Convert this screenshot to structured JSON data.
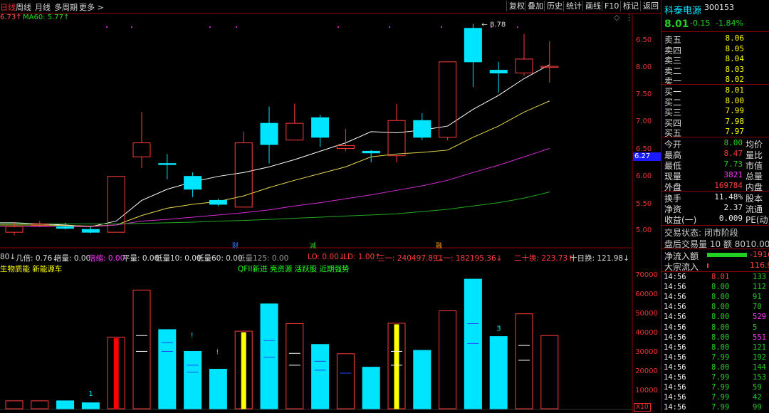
{
  "toolbar": {
    "tabs": [
      "日线",
      "周线",
      "月线",
      "多周期",
      "更多 >"
    ],
    "buttons": [
      "复权",
      "叠加",
      "历史",
      "统计",
      "画线",
      "F10",
      "标记",
      "返回"
    ]
  },
  "ma_header": {
    "ma_last": "6.73↑",
    "ma60": "MA60: 5.77↑"
  },
  "price_axis": [
    "6.50",
    "6.00",
    "5.50",
    "5.00",
    "6.27",
    "7.50",
    "7.00",
    "8.00"
  ],
  "axis_price_list": [
    "6.50",
    "6.00",
    "5.50",
    "5.00"
  ],
  "axis_upper": [
    "8.00",
    "7.50",
    "7.00"
  ],
  "current_price_tag": "6.27",
  "high_label": "8.78",
  "event_markers": [
    "财",
    "减",
    "融"
  ],
  "indicator_line": {
    "a": "80↓",
    "b": "几倍: 0.76↓",
    "c": "倍量: 0.00",
    "d": "倍缩: 0.00",
    "e": "平量: 0.00",
    "f": "低量10: 0.00",
    "g": "低量60: 0.00",
    "h": "低量125: 0.00",
    "i": "LO: 0.00↓",
    "j": "LD: 1.00↑",
    "k": "三一: 240497.89↓",
    "l": "二一: 182195.36↓",
    "m": "二十换: 223.73↑",
    "n": "十日换: 121.98↓"
  },
  "concepts_left": "生物质能 新能源车",
  "concepts_mid": "QFII新进 壳资源 活跃股 近期强势",
  "vol_axis": [
    "70000",
    "60000",
    "50000",
    "40000",
    "30000",
    "20000",
    "10000"
  ],
  "vol_unit": "X10",
  "vol_annotations": [
    "1",
    "!",
    "!",
    "3"
  ],
  "chart_data": {
    "type": "candlestick",
    "candles": [
      {
        "o": 5.05,
        "c": 5.15,
        "h": 5.22,
        "l": 5.0,
        "dir": "up"
      },
      {
        "o": 5.2,
        "c": 5.17,
        "h": 5.25,
        "l": 5.15,
        "dir": "up"
      },
      {
        "o": 5.15,
        "c": 5.12,
        "h": 5.22,
        "l": 5.1,
        "dir": "down"
      },
      {
        "o": 5.1,
        "c": 5.05,
        "h": 5.15,
        "l": 5.03,
        "dir": "down"
      },
      {
        "o": 5.05,
        "c": 6.05,
        "h": 6.05,
        "l": 5.05,
        "dir": "up"
      },
      {
        "o": 6.4,
        "c": 6.65,
        "h": 7.2,
        "l": 6.2,
        "dir": "up"
      },
      {
        "o": 6.28,
        "c": 6.27,
        "h": 6.45,
        "l": 6.0,
        "dir": "down"
      },
      {
        "o": 6.05,
        "c": 5.82,
        "h": 6.12,
        "l": 5.68,
        "dir": "down"
      },
      {
        "o": 5.62,
        "c": 5.55,
        "h": 5.65,
        "l": 5.52,
        "dir": "down"
      },
      {
        "o": 5.5,
        "c": 6.65,
        "h": 6.85,
        "l": 5.5,
        "dir": "up"
      },
      {
        "o": 7.0,
        "c": 6.62,
        "h": 7.3,
        "l": 6.28,
        "dir": "down"
      },
      {
        "o": 6.7,
        "c": 7.0,
        "h": 7.35,
        "l": 6.7,
        "dir": "up"
      },
      {
        "o": 7.1,
        "c": 6.75,
        "h": 7.15,
        "l": 6.58,
        "dir": "down"
      },
      {
        "o": 6.55,
        "c": 6.6,
        "h": 6.9,
        "l": 6.5,
        "dir": "up"
      },
      {
        "o": 6.5,
        "c": 6.47,
        "h": 6.52,
        "l": 6.3,
        "dir": "down"
      },
      {
        "o": 6.42,
        "c": 7.05,
        "h": 7.35,
        "l": 6.3,
        "dir": "up"
      },
      {
        "o": 7.05,
        "c": 6.75,
        "h": 7.18,
        "l": 6.7,
        "dir": "down"
      },
      {
        "o": 6.75,
        "c": 8.1,
        "h": 8.1,
        "l": 6.7,
        "dir": "up"
      },
      {
        "o": 8.7,
        "c": 8.1,
        "h": 8.78,
        "l": 7.65,
        "dir": "down"
      },
      {
        "o": 7.95,
        "c": 7.9,
        "h": 8.1,
        "l": 7.55,
        "dir": "down"
      },
      {
        "o": 7.9,
        "c": 8.15,
        "h": 8.6,
        "l": 7.85,
        "dir": "up"
      },
      {
        "o": 8.02,
        "c": 8.01,
        "h": 8.47,
        "l": 7.73,
        "dir": "up"
      }
    ],
    "volumes": [
      4000,
      4000,
      4000,
      3000,
      35500,
      60000,
      40000,
      29000,
      20000,
      38500,
      53000,
      43000,
      32500,
      27800,
      21000,
      42500,
      29500,
      49500,
      65500,
      36500,
      48000,
      37000
    ],
    "vol_bar_color": [
      "up",
      "up",
      "down",
      "down",
      "red_solid",
      "up",
      "down",
      "down",
      "down",
      "yellow_solid",
      "down",
      "up",
      "down",
      "up",
      "down",
      "yellow_solid",
      "down",
      "up",
      "down",
      "down",
      "up",
      "up"
    ],
    "ma_lines": [
      {
        "name": "MA5",
        "color": "#ffffff",
        "values": [
          5.22,
          5.2,
          5.18,
          5.15,
          5.25,
          5.62,
          5.82,
          5.95,
          6.05,
          6.12,
          6.22,
          6.35,
          6.5,
          6.65,
          6.85,
          6.83,
          6.88,
          6.95,
          7.25,
          7.5,
          7.8,
          8.05
        ]
      },
      {
        "name": "MA10",
        "color": "#e6d84a",
        "values": [
          5.18,
          5.18,
          5.17,
          5.16,
          5.18,
          5.35,
          5.48,
          5.55,
          5.6,
          5.7,
          5.85,
          5.98,
          6.1,
          6.22,
          6.4,
          6.45,
          6.48,
          6.52,
          6.75,
          6.95,
          7.2,
          7.4
        ]
      },
      {
        "name": "MA30",
        "color": "#d42bd4",
        "values": [
          5.15,
          5.15,
          5.15,
          5.15,
          5.18,
          5.25,
          5.28,
          5.32,
          5.36,
          5.4,
          5.45,
          5.52,
          5.58,
          5.65,
          5.72,
          5.8,
          5.88,
          5.98,
          6.12,
          6.25,
          6.4,
          6.55
        ]
      },
      {
        "name": "MA60",
        "color": "#22aa22",
        "values": [
          5.2,
          5.2,
          5.2,
          5.2,
          5.2,
          5.21,
          5.22,
          5.23,
          5.25,
          5.26,
          5.28,
          5.3,
          5.32,
          5.34,
          5.36,
          5.38,
          5.42,
          5.46,
          5.52,
          5.58,
          5.66,
          5.77
        ]
      }
    ],
    "ylim": [
      4.95,
      8.85
    ],
    "vol_ylim": [
      0,
      72000
    ]
  },
  "panel": {
    "name": "科泰电源",
    "code": "300153",
    "price": "8.01",
    "change": "-0.15",
    "change_pct": "-1.84%",
    "asks": [
      {
        "label": "卖五",
        "p": "8.06"
      },
      {
        "label": "卖四",
        "p": "8.05"
      },
      {
        "label": "卖三",
        "p": "8.04"
      },
      {
        "label": "卖二",
        "p": "8.03"
      },
      {
        "label": "卖一",
        "p": "8.02"
      }
    ],
    "bids": [
      {
        "label": "买一",
        "p": "8.01"
      },
      {
        "label": "买二",
        "p": "8.00"
      },
      {
        "label": "买三",
        "p": "7.99"
      },
      {
        "label": "买四",
        "p": "7.98"
      },
      {
        "label": "买五",
        "p": "7.97"
      }
    ],
    "stats": [
      {
        "l": "今开",
        "v": "8.00",
        "r": "均价",
        "c": "grn"
      },
      {
        "l": "最高",
        "v": "8.47",
        "r": "量比",
        "c": "red"
      },
      {
        "l": "最低",
        "v": "7.73",
        "r": "市值",
        "c": "grn"
      },
      {
        "l": "现量",
        "v": "3821",
        "r": "总量",
        "c": "mag"
      },
      {
        "l": "外盘",
        "v": "169784",
        "r": "内盘",
        "c": "red"
      }
    ],
    "stats2": [
      {
        "l": "换手",
        "v": "11.48%",
        "r": "股本"
      },
      {
        "l": "净资",
        "v": "2.37",
        "r": "流通"
      },
      {
        "l": "收益(一)",
        "v": "0.009",
        "r": "PE(动)"
      }
    ],
    "trade_status": "交易状态: 闭市阶段",
    "after_hours": "盘后交易量 10 额 8010.00",
    "net_inflow_label": "净流入额",
    "net_inflow": "-1916",
    "big_inflow_label": "大宗流入",
    "big_inflow": "116.9",
    "ticks": [
      {
        "t": "14:56",
        "p": "8.01",
        "v": "133",
        "c": "grn"
      },
      {
        "t": "14:56",
        "p": "8.00",
        "v": "112",
        "c": "grn"
      },
      {
        "t": "14:56",
        "p": "8.00",
        "v": "91",
        "c": "grn"
      },
      {
        "t": "14:56",
        "p": "8.00",
        "v": "70",
        "c": "grn"
      },
      {
        "t": "14:56",
        "p": "8.00",
        "v": "529",
        "c": "mag"
      },
      {
        "t": "14:56",
        "p": "8.00",
        "v": "5",
        "c": "grn"
      },
      {
        "t": "14:56",
        "p": "8.00",
        "v": "551",
        "c": "mag"
      },
      {
        "t": "14:56",
        "p": "8.00",
        "v": "121",
        "c": "grn"
      },
      {
        "t": "14:56",
        "p": "7.99",
        "v": "192",
        "c": "grn"
      },
      {
        "t": "14:56",
        "p": "8.00",
        "v": "144",
        "c": "grn"
      },
      {
        "t": "14:56",
        "p": "7.99",
        "v": "153",
        "c": "grn"
      },
      {
        "t": "14:56",
        "p": "7.99",
        "v": "59",
        "c": "grn"
      },
      {
        "t": "14:56",
        "p": "7.99",
        "v": "42",
        "c": "grn"
      },
      {
        "t": "14:56",
        "p": "7.99",
        "v": "99",
        "c": "grn"
      }
    ]
  }
}
